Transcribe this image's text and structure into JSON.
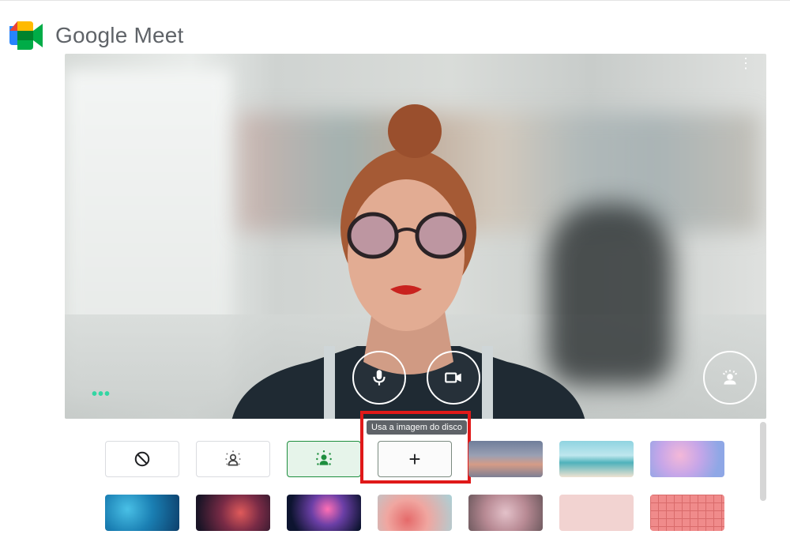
{
  "app": {
    "name": "Google Meet"
  },
  "controls": {
    "menu_icon": "more-vert-icon",
    "microphone_icon": "microphone-icon",
    "camera_icon": "camera-icon",
    "visual_effects_icon": "visual-effects-icon"
  },
  "effects": {
    "tooltip": "Usa a imagem do disco",
    "add_label": "+",
    "tiles_row1": [
      {
        "name": "no-effect",
        "icon": "block-icon"
      },
      {
        "name": "slight-blur",
        "icon": "blur-person-icon"
      },
      {
        "name": "blur",
        "icon": "blur-person-icon",
        "selected": true
      },
      {
        "name": "upload-image",
        "icon": "plus-icon"
      }
    ],
    "thumbnails_row1": [
      "sunset",
      "beach",
      "pink-clouds"
    ],
    "thumbnails_row2": [
      "blue-waves",
      "galaxy",
      "fireworks",
      "flowers",
      "blossoms",
      "pink-dots",
      "pink-grid"
    ]
  },
  "colors": {
    "accent_green": "#1e8e3e",
    "highlight_red": "#e01919"
  }
}
